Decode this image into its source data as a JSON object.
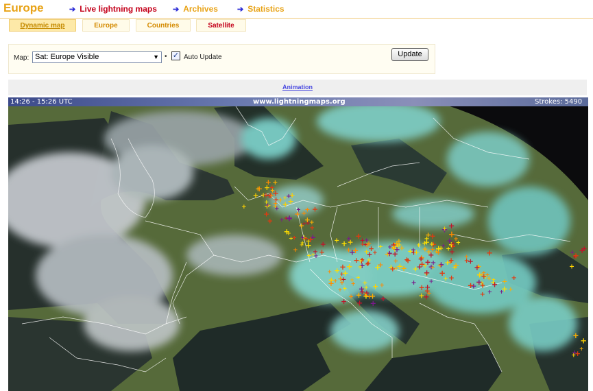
{
  "header": {
    "title": "Europe",
    "nav": [
      {
        "label": "Live lightning maps"
      },
      {
        "label": "Archives"
      },
      {
        "label": "Statistics"
      }
    ]
  },
  "tabs": [
    {
      "label": "Dynamic map",
      "active": true
    },
    {
      "label": "Europe"
    },
    {
      "label": "Countries"
    },
    {
      "label": "Satellite"
    }
  ],
  "controls": {
    "map_label": "Map:",
    "map_value": "Sat: Europe Visible",
    "auto_update_label": "Auto Update",
    "auto_update_checked": true,
    "update_button": "Update"
  },
  "animation_link": "Animation",
  "map": {
    "time_range": "14:26 - 15:26 UTC",
    "site": "www.lightningmaps.org",
    "strokes_label": "Strokes:",
    "strokes_count": "5490",
    "colors": {
      "land": "#5a6e3c",
      "sea": "#1e2a26",
      "cloud": "#6ecfc8",
      "lightning_new": "#ffe000",
      "lightning_old": "#c0142a"
    }
  },
  "colors": {
    "accent": "#e8a317",
    "nav_red": "#c4001a",
    "arrow_blue": "#2b2bd6",
    "link_blue": "#4a4ae0"
  }
}
